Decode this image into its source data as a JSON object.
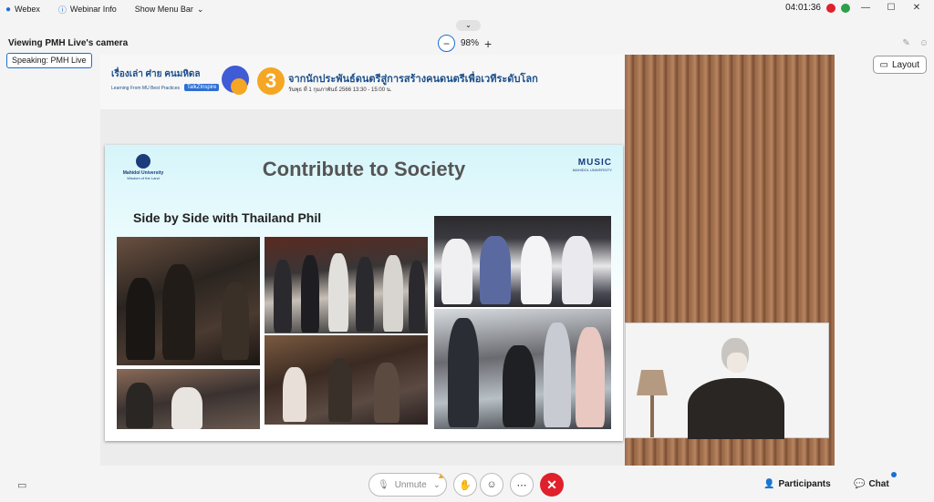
{
  "titlebar": {
    "app_name": "Webex",
    "webinar_info": "Webinar Info",
    "show_menu_bar": "Show Menu Bar",
    "clock": "04:01:36",
    "minimize": "—",
    "maximize": "☐",
    "close": "✕"
  },
  "viewing_label": "Viewing PMH Live's camera",
  "zoom": {
    "value": "98%",
    "minus": "−",
    "plus": "+"
  },
  "speaking": {
    "label": "Speaking:",
    "name": "PMH Live"
  },
  "layout_button": "Layout",
  "banner": {
    "logo_text": "เรื่องเล่า ศ่าย คนมหิดล",
    "logo_sub": "Learning From MU Best Practices",
    "tag": "TalkZInspire",
    "episode": "3",
    "title": "จากนักประพันธ์ดนตรีสู่การสร้างคนดนตรีเพื่อเวทีระดับโลก",
    "date": "วันพุธ ที่ 1 กุมภาพันธ์ 2566 13:30 - 15:00 น."
  },
  "slide": {
    "title": "Contribute to Society",
    "subtitle": "Side by Side with Thailand Phil",
    "mu_name": "Mahidol University",
    "mu_motto": "Wisdom of the Land",
    "music_word": "MUSIC",
    "music_sub": "MAHIDOL UNIVERSITY"
  },
  "toolbar": {
    "unmute": "Unmute",
    "participants": "Participants",
    "chat": "Chat"
  },
  "colors": {
    "accent_blue": "#1a6fd1",
    "end_red": "#e0202a",
    "warning": "#f5a623"
  }
}
